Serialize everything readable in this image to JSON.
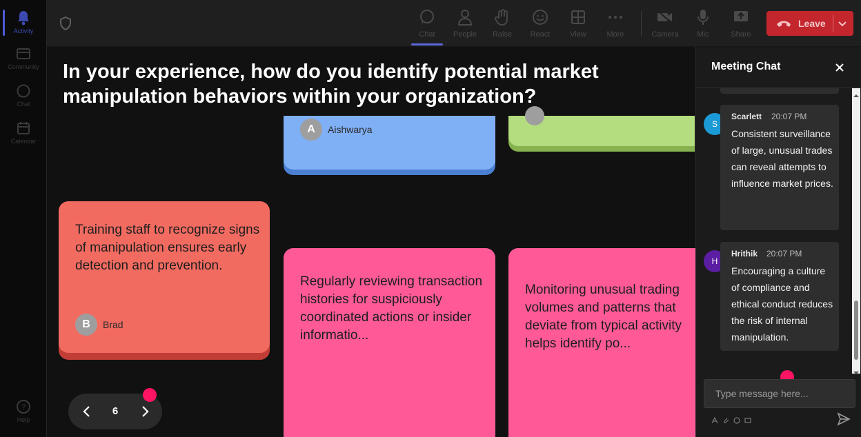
{
  "rail": {
    "items": [
      {
        "label": "Activity",
        "icon": "bell-icon"
      },
      {
        "label": "Community",
        "icon": "community-icon"
      },
      {
        "label": "Chat",
        "icon": "chat-icon"
      },
      {
        "label": "Calendar",
        "icon": "calendar-icon"
      },
      {
        "label": "Help",
        "icon": "help-icon"
      }
    ]
  },
  "toolbar": {
    "chat": "Chat",
    "people": "People",
    "raise": "Raise",
    "react": "React",
    "view": "View",
    "more": "More",
    "camera": "Camera",
    "mic": "Mic",
    "share": "Share",
    "leave": "Leave"
  },
  "stage": {
    "question": "In your experience, how do you identify potential market manipulation behaviors within your organization?",
    "cards": {
      "blue": {
        "author": "Aishwarya",
        "initial": "A"
      },
      "red": {
        "text": "Training staff to recognize signs of manipulation ensures early detection and prevention.",
        "author": "Brad",
        "initial": "B"
      },
      "pink1": {
        "text": "Regularly reviewing transaction histories for suspiciously coordinated actions or insider informatio..."
      },
      "pink2": {
        "text": "Monitoring unusual trading volumes and patterns that deviate from typical activity helps identify po..."
      }
    },
    "pager": {
      "page": "6"
    }
  },
  "chat": {
    "title": "Meeting Chat",
    "messages": [
      {
        "name": "Scarlett",
        "initial": "S",
        "time": "20:07 PM",
        "text": "Consistent surveillance of large, unusual trades can reveal attempts to influence market prices.",
        "avatar_color": "#1b9ad6"
      },
      {
        "name": "Hrithik",
        "initial": "H",
        "time": "20:07 PM",
        "text": "Encouraging a culture of compliance and ethical conduct reduces the risk of internal manipulation.",
        "avatar_color": "#5b1ea3"
      }
    ],
    "input_placeholder": "Type message here..."
  },
  "colors": {
    "accent": "#5b67d8",
    "leave": "#c4262e",
    "pointer_dot": "#ff1464"
  }
}
